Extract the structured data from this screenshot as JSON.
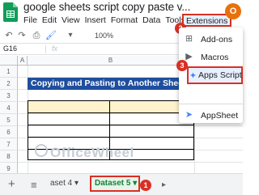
{
  "app": {
    "doc_title": "google sheets script copy paste v...",
    "avatar_initial": "O"
  },
  "menu": {
    "items": [
      "File",
      "Edit",
      "View",
      "Insert",
      "Format",
      "Data",
      "Tools"
    ],
    "extensions": "Extensions"
  },
  "toolbar": {
    "zoom_label": "100%"
  },
  "formula_bar": {
    "cell_ref": "G16",
    "fx": "fx"
  },
  "grid": {
    "columns": [
      "A",
      "B"
    ],
    "rows": [
      "1",
      "2",
      "3",
      "4",
      "5",
      "6",
      "7",
      "8",
      "9"
    ],
    "banner_text": "Copying and Pasting to Another Sheet"
  },
  "watermark": {
    "text": "OfficeWheel"
  },
  "sheets": {
    "prev_tab": "aset 4",
    "active_tab": "Dataset 5"
  },
  "steps": {
    "one": "1",
    "two": "2",
    "three": "3"
  },
  "extensions_menu": {
    "items": [
      {
        "label": "Add-ons",
        "icon": "addons-icon"
      },
      {
        "label": "Macros",
        "icon": "macros-icon"
      },
      {
        "label": "Apps Script",
        "icon": "apps-script-icon"
      },
      {
        "label": "AppSheet",
        "icon": "appsheet-icon"
      }
    ]
  },
  "colors": {
    "accent_red": "#d93025",
    "banner_blue": "#1f4e9e",
    "header_fill": "#fff2cc",
    "sheets_green": "#188038"
  }
}
